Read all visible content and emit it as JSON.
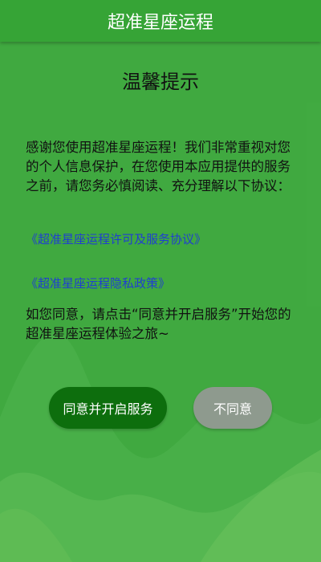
{
  "app": {
    "title": "超准星座运程"
  },
  "dialog": {
    "title": "温馨提示",
    "body": "感谢您使用超准星座运程！我们非常重视对您的个人信息保护，在您使用本应用提供的服务之前，请您务必慎阅读、充分理解以下协议：",
    "link_license": "《超准星座运程许可及服务协议》",
    "link_privacy": "《超准星座运程隐私政策》",
    "footer": "如您同意，请点击“同意并开启服务”开始您的超准星座运程体验之旅~",
    "agree_button": "同意并开启服务",
    "disagree_button": "不同意"
  },
  "colors": {
    "background": "#3aa33a",
    "topbar": "#36a436",
    "agree_button": "#0d6e0d",
    "disagree_button": "#8e9a8e",
    "link": "#1f3fd0"
  }
}
